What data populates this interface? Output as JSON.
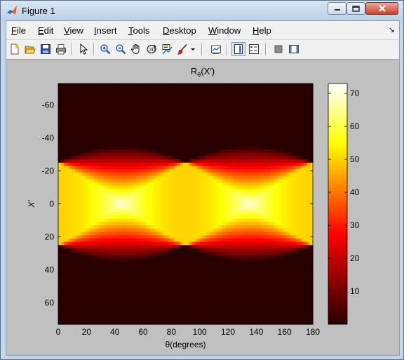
{
  "window": {
    "title": "Figure 1"
  },
  "menu": [
    {
      "label": "File",
      "key": "F",
      "rest": "ile"
    },
    {
      "label": "Edit",
      "key": "E",
      "rest": "dit"
    },
    {
      "label": "View",
      "key": "V",
      "rest": "iew"
    },
    {
      "label": "Insert",
      "key": "I",
      "rest": "nsert"
    },
    {
      "label": "Tools",
      "key": "T",
      "rest": "ools"
    },
    {
      "label": "Desktop",
      "key": "D",
      "rest": "esktop"
    },
    {
      "label": "Window",
      "key": "W",
      "rest": "indow"
    },
    {
      "label": "Help",
      "key": "H",
      "rest": "elp"
    }
  ],
  "toolbar": [
    "new-figure-icon",
    "open-file-icon",
    "save-icon",
    "print-icon",
    "edit-plot-arrow-icon",
    "zoom-in-icon",
    "zoom-out-icon",
    "pan-hand-icon",
    "rotate-3d-icon",
    "data-cursor-icon",
    "brush-icon",
    "brush-dropdown-icon",
    "link-plot-icon",
    "colorbar-icon",
    "legend-icon",
    "hide-plot-tools-icon",
    "show-plot-tools-icon"
  ],
  "chart_data": {
    "type": "heatmap",
    "title_main": "R",
    "title_sub": "θ",
    "title_arg": "(X′)",
    "xlabel": "θ(degrees)",
    "ylabel": "X′",
    "xlim": [
      0,
      180
    ],
    "ylim": [
      -73,
      73
    ],
    "y_reversed": true,
    "xticks": [
      "0",
      "20",
      "40",
      "60",
      "80",
      "100",
      "120",
      "140",
      "160",
      "180"
    ],
    "xtick_values": [
      0,
      20,
      40,
      60,
      80,
      100,
      120,
      140,
      160,
      180
    ],
    "yticks": [
      "-60",
      "-40",
      "-20",
      "0",
      "20",
      "40",
      "60"
    ],
    "ytick_values": [
      -60,
      -40,
      -20,
      0,
      20,
      40,
      60
    ],
    "colormap": "hot",
    "clim": [
      0,
      73
    ],
    "colorbar_ticks": [
      "10",
      "20",
      "30",
      "40",
      "50",
      "60",
      "70"
    ],
    "colorbar_values": [
      10,
      20,
      30,
      40,
      50,
      60,
      70
    ],
    "square_half_width": 25,
    "peak_positions": [
      [
        45,
        0
      ],
      [
        135,
        0
      ]
    ]
  }
}
